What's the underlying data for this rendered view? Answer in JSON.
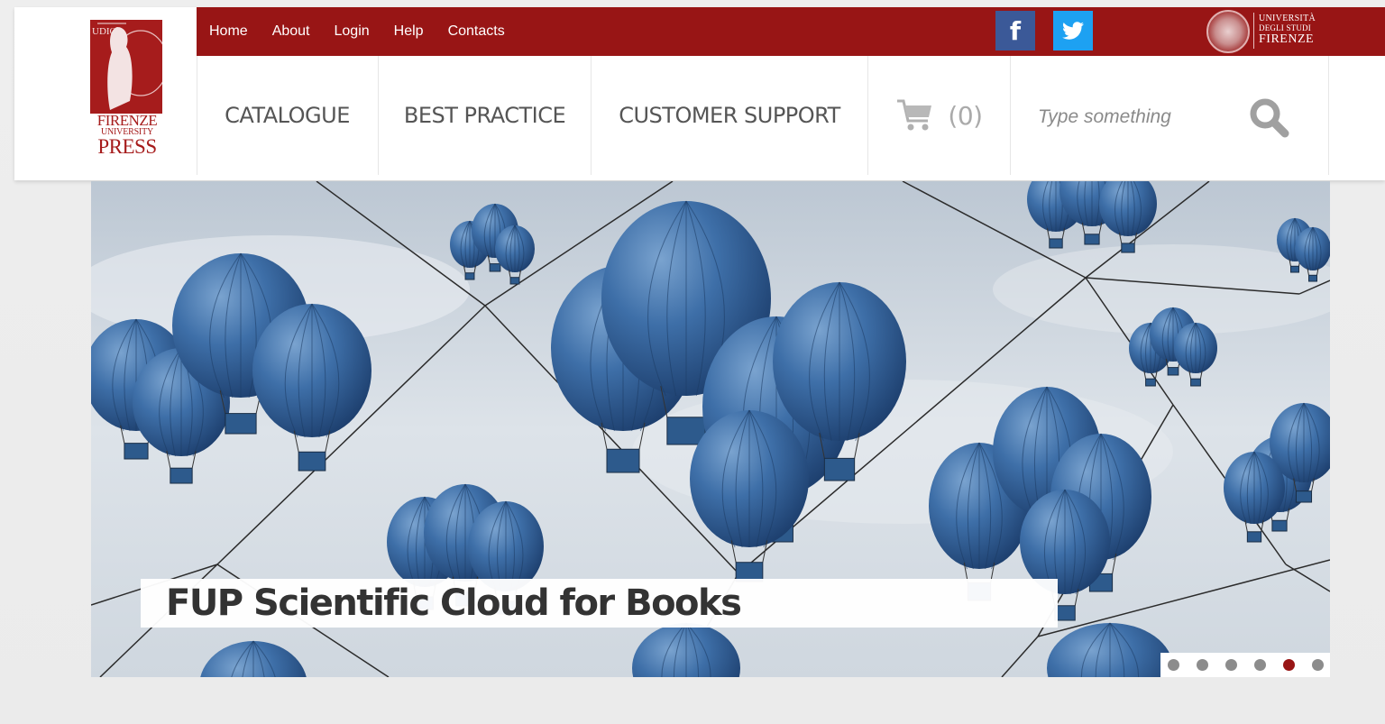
{
  "brand": {
    "logo_lines": [
      "FIRENZE",
      "UNIVERSITY",
      "PRESS"
    ],
    "university_lines": [
      "UNIVERSITÀ",
      "DEGLI STUDI",
      "FIRENZE"
    ],
    "accent_color": "#981515"
  },
  "topbar": {
    "links": [
      "Home",
      "About",
      "Login",
      "Help",
      "Contacts"
    ],
    "social": [
      {
        "name": "facebook-icon",
        "glyph": "f"
      },
      {
        "name": "twitter-icon",
        "glyph": ""
      }
    ]
  },
  "nav": {
    "items": [
      "CATALOGUE",
      "BEST PRACTICE",
      "CUSTOMER SUPPORT"
    ],
    "cart_count": "(0)"
  },
  "search": {
    "placeholder": "Type something",
    "value": ""
  },
  "slider": {
    "caption": "FUP Scientific Cloud for Books",
    "slide_count": 6,
    "active_index": 4
  }
}
